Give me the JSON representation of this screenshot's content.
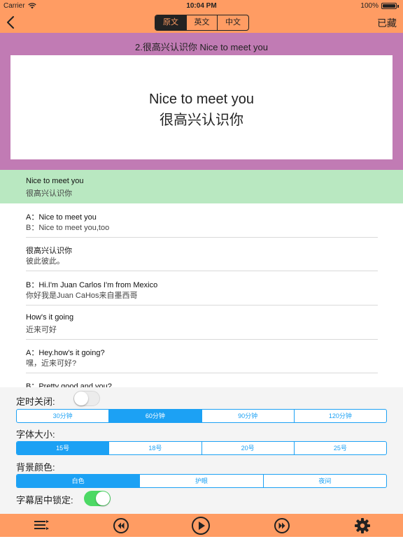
{
  "status": {
    "carrier": "Carrier",
    "time": "10:04 PM",
    "battery": "100%"
  },
  "nav": {
    "segments": [
      {
        "label": "原文",
        "selected": true
      },
      {
        "label": "英文",
        "selected": false
      },
      {
        "label": "中文",
        "selected": false
      }
    ],
    "collected_label": "已藏"
  },
  "lesson": {
    "title": "2.很高兴认识你  Nice to meet you",
    "card_en": "Nice to meet you",
    "card_zh": "很高兴认识你"
  },
  "sentences": [
    {
      "line1": "Nice to meet you",
      "line2": "很高兴认识你",
      "active": true
    },
    {
      "line1": "A：Nice to meet you",
      "line2": "B：Nice to meet you,too",
      "active": false
    },
    {
      "line1": "很高兴认识你",
      "line2": "彼此彼此。",
      "active": false
    },
    {
      "line1": "B：Hi.I'm Juan Carlos I'm from Mexico",
      "line2": "你好我是Juan CaHos来自墨西哥",
      "active": false
    },
    {
      "line1": "How's it going",
      "line2": "近来可好",
      "active": false
    },
    {
      "line1": "A：Hey.how's it going?",
      "line2": "嘿，近来可好?",
      "active": false
    },
    {
      "line1": "B：Pretty good.and you?",
      "line2": "",
      "active": false
    }
  ],
  "settings": {
    "timer": {
      "label": "定时关闭:",
      "enabled": false,
      "options": [
        "30分钟",
        "60分钟",
        "90分钟",
        "120分钟"
      ],
      "selected": 1
    },
    "font_size": {
      "label": "字体大小:",
      "options": [
        "15号",
        "18号",
        "20号",
        "25号"
      ],
      "selected": 0
    },
    "background": {
      "label": "背景颜色:",
      "options": [
        "白色",
        "护眼",
        "夜间"
      ],
      "selected": 0
    },
    "lock_center": {
      "label": "字幕居中锁定:",
      "enabled": true
    }
  },
  "toolbar": {
    "icons": [
      "playlist-icon",
      "previous-icon",
      "play-icon",
      "next-icon",
      "settings-gear-icon"
    ]
  },
  "colors": {
    "bar": "#ff9c63",
    "panel": "#c17bb4",
    "active_row": "#b9e8c1",
    "accent": "#1ca1f4",
    "switch_on": "#4cd964"
  }
}
